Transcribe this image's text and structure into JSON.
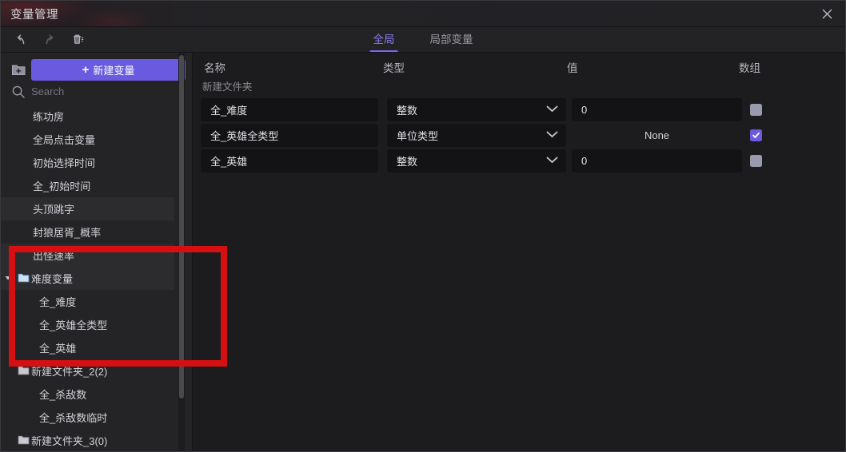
{
  "window": {
    "title": "变量管理",
    "close_icon": "close-icon"
  },
  "toolbar": {
    "undo_icon": "undo-icon",
    "redo_icon": "redo-icon",
    "delete_icon": "trash-icon",
    "tabs": [
      {
        "label": "全局",
        "active": true
      },
      {
        "label": "局部变量",
        "active": false
      }
    ]
  },
  "sidebar": {
    "new_folder_icon": "new-folder-icon",
    "new_variable_button": "新建变量",
    "new_variable_plus": "+",
    "search_icon": "search-icon",
    "search_placeholder": "Search",
    "search_value": "",
    "items": [
      {
        "label": "练功房",
        "type": "variable",
        "indent": 1,
        "shade": false
      },
      {
        "label": "全局点击变量",
        "type": "variable",
        "indent": 1,
        "shade": false
      },
      {
        "label": "初始选择时间",
        "type": "variable",
        "indent": 1,
        "shade": false
      },
      {
        "label": "全_初始时间",
        "type": "variable",
        "indent": 1,
        "shade": false
      },
      {
        "label": "头顶跳字",
        "type": "variable",
        "indent": 1,
        "shade": true
      },
      {
        "label": "封狼居胥_概率",
        "type": "variable",
        "indent": 1,
        "shade": false
      },
      {
        "label": "出怪速率",
        "type": "variable",
        "indent": 1,
        "shade": true
      },
      {
        "label": "难度变量",
        "type": "folder-open",
        "indent": 0,
        "shade": true
      },
      {
        "label": "全_难度",
        "type": "variable",
        "indent": 2,
        "shade": false
      },
      {
        "label": "全_英雄全类型",
        "type": "variable",
        "indent": 2,
        "shade": false
      },
      {
        "label": "全_英雄",
        "type": "variable",
        "indent": 2,
        "shade": false
      },
      {
        "label": "新建文件夹_2(2)",
        "type": "folder",
        "indent": 0,
        "shade": false
      },
      {
        "label": "全_杀敌数",
        "type": "variable",
        "indent": 2,
        "shade": false
      },
      {
        "label": "全_杀敌数临时",
        "type": "variable",
        "indent": 2,
        "shade": false
      },
      {
        "label": "新建文件夹_3(0)",
        "type": "folder",
        "indent": 0,
        "shade": false
      }
    ]
  },
  "main": {
    "columns": {
      "name": "名称",
      "type": "类型",
      "value": "值",
      "array": "数组"
    },
    "group_label": "新建文件夹",
    "rows": [
      {
        "name": "全_难度",
        "type": "整数",
        "value": "0",
        "value_boxed": true,
        "array_checked": false
      },
      {
        "name": "全_英雄全类型",
        "type": "单位类型",
        "value": "None",
        "value_boxed": false,
        "array_checked": true
      },
      {
        "name": "全_英雄",
        "type": "整数",
        "value": "0",
        "value_boxed": true,
        "array_checked": false
      }
    ]
  },
  "annotation": {
    "shape": "rectangle",
    "color": "#d60f12"
  },
  "colors": {
    "accent_purple": "#6a5ae0",
    "tab_active": "#8a7ef0",
    "annotation_red": "#d60f12",
    "panel_bg": "#1c1c1e",
    "sidebar_bg": "#242426",
    "field_bg": "#131315"
  }
}
